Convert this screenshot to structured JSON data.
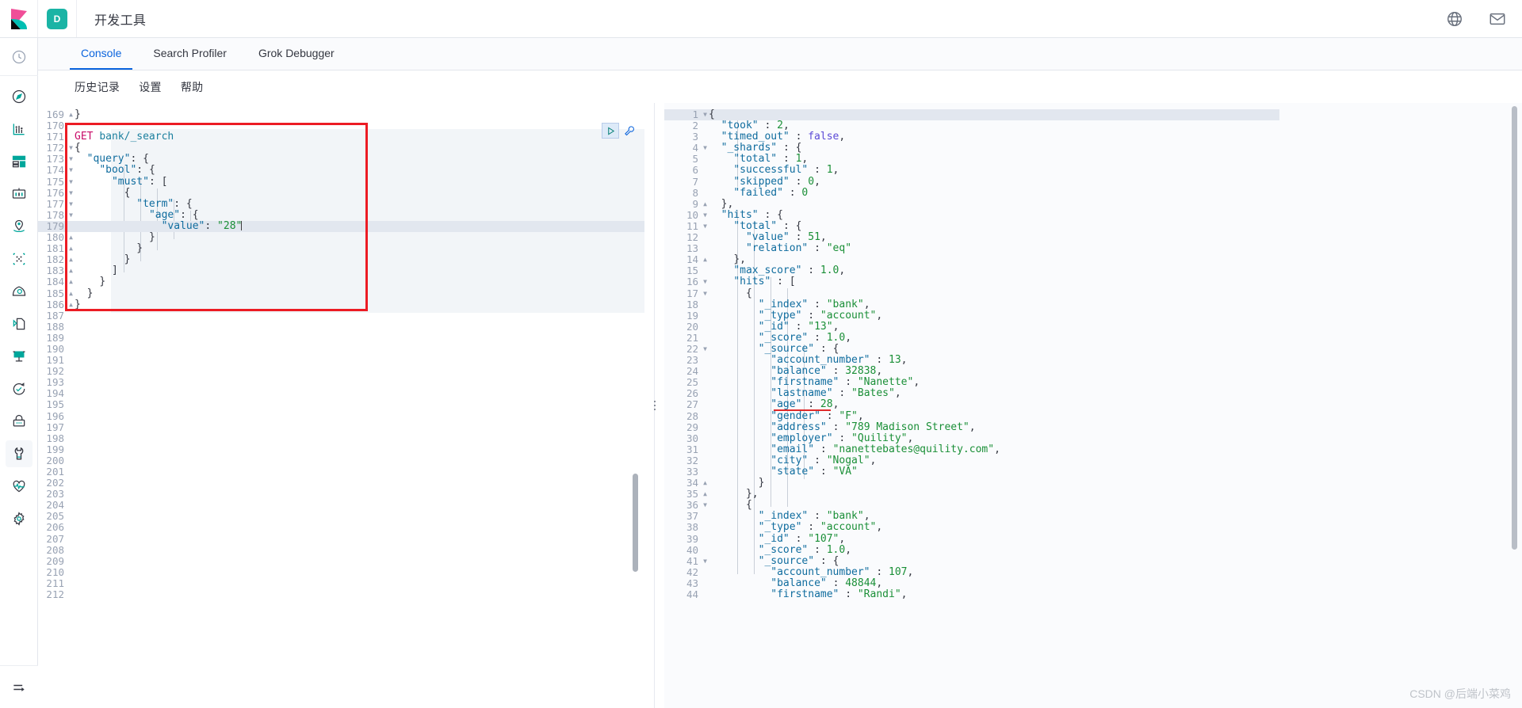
{
  "header": {
    "logo_icon": "kibana-logo",
    "space_badge": "D",
    "title": "开发工具",
    "icons": [
      {
        "name": "help-globe-icon"
      },
      {
        "name": "mail-icon"
      }
    ]
  },
  "sidebar": {
    "recent_icon": "recently-viewed-clock-icon",
    "items": [
      {
        "name": "sidebar-item-discover",
        "icon": "compass-icon",
        "active": false
      },
      {
        "name": "sidebar-item-visualize",
        "icon": "bar-chart-icon",
        "active": false
      },
      {
        "name": "sidebar-item-dashboard",
        "icon": "dashboard-icon",
        "active": false
      },
      {
        "name": "sidebar-item-canvas",
        "icon": "canvas-icon",
        "active": false
      },
      {
        "name": "sidebar-item-maps",
        "icon": "map-marker-icon",
        "active": false
      },
      {
        "name": "sidebar-item-machine-learning",
        "icon": "machine-learning-icon",
        "active": false
      },
      {
        "name": "sidebar-item-infrastructure",
        "icon": "infrastructure-icon",
        "active": false
      },
      {
        "name": "sidebar-item-logs",
        "icon": "logs-icon",
        "active": false
      },
      {
        "name": "sidebar-item-apm",
        "icon": "apm-icon",
        "active": false
      },
      {
        "name": "sidebar-item-uptime",
        "icon": "uptime-clock-icon",
        "active": false
      },
      {
        "name": "sidebar-item-security",
        "icon": "lock-icon",
        "active": false
      },
      {
        "name": "sidebar-item-dev-tools",
        "icon": "wrench-icon",
        "active": true
      },
      {
        "name": "sidebar-item-monitoring",
        "icon": "heartbeat-icon",
        "active": false
      },
      {
        "name": "sidebar-item-management",
        "icon": "gear-icon",
        "active": false
      }
    ],
    "collapse_icon": "collapse-nav-arrow-icon"
  },
  "tabs": [
    {
      "label": "Console",
      "active": true
    },
    {
      "label": "Search Profiler",
      "active": false
    },
    {
      "label": "Grok Debugger",
      "active": false
    }
  ],
  "subbar": {
    "links": [
      {
        "label": "历史记录",
        "name": "history-link"
      },
      {
        "label": "设置",
        "name": "settings-link"
      },
      {
        "label": "帮助",
        "name": "help-link"
      }
    ]
  },
  "request_editor": {
    "name": "console-request-editor",
    "play_button_icon": "play-triangle-icon",
    "wrench_button_icon": "wrench-icon",
    "first_line_number": 169,
    "last_line_number": 212,
    "highlighted_line": 179,
    "lines": [
      {
        "n": 169,
        "fold": "up",
        "text": "}"
      },
      {
        "n": 170,
        "fold": "",
        "text": ""
      },
      {
        "n": 171,
        "fold": "",
        "text": "GET bank/_search"
      },
      {
        "n": 172,
        "fold": "down",
        "text": "{"
      },
      {
        "n": 173,
        "fold": "down",
        "text": "  \"query\": {"
      },
      {
        "n": 174,
        "fold": "down",
        "text": "    \"bool\": {"
      },
      {
        "n": 175,
        "fold": "down",
        "text": "      \"must\": ["
      },
      {
        "n": 176,
        "fold": "down",
        "text": "        {"
      },
      {
        "n": 177,
        "fold": "down",
        "text": "          \"term\": {"
      },
      {
        "n": 178,
        "fold": "down",
        "text": "            \"age\": {"
      },
      {
        "n": 179,
        "fold": "",
        "text": "              \"value\": \"28\""
      },
      {
        "n": 180,
        "fold": "up",
        "text": "            }"
      },
      {
        "n": 181,
        "fold": "up",
        "text": "          }"
      },
      {
        "n": 182,
        "fold": "up",
        "text": "        }"
      },
      {
        "n": 183,
        "fold": "up",
        "text": "      ]"
      },
      {
        "n": 184,
        "fold": "up",
        "text": "    }"
      },
      {
        "n": 185,
        "fold": "up",
        "text": "  }"
      },
      {
        "n": 186,
        "fold": "up",
        "text": "}"
      },
      {
        "n": 187,
        "fold": "",
        "text": ""
      },
      {
        "n": 188,
        "fold": "",
        "text": ""
      },
      {
        "n": 189,
        "fold": "",
        "text": ""
      },
      {
        "n": 190,
        "fold": "",
        "text": ""
      },
      {
        "n": 191,
        "fold": "",
        "text": ""
      },
      {
        "n": 192,
        "fold": "",
        "text": ""
      },
      {
        "n": 193,
        "fold": "",
        "text": ""
      },
      {
        "n": 194,
        "fold": "",
        "text": ""
      },
      {
        "n": 195,
        "fold": "",
        "text": ""
      },
      {
        "n": 196,
        "fold": "",
        "text": ""
      },
      {
        "n": 197,
        "fold": "",
        "text": ""
      },
      {
        "n": 198,
        "fold": "",
        "text": ""
      },
      {
        "n": 199,
        "fold": "",
        "text": ""
      },
      {
        "n": 200,
        "fold": "",
        "text": ""
      },
      {
        "n": 201,
        "fold": "",
        "text": ""
      },
      {
        "n": 202,
        "fold": "",
        "text": ""
      },
      {
        "n": 203,
        "fold": "",
        "text": ""
      },
      {
        "n": 204,
        "fold": "",
        "text": ""
      },
      {
        "n": 205,
        "fold": "",
        "text": ""
      },
      {
        "n": 206,
        "fold": "",
        "text": ""
      },
      {
        "n": 207,
        "fold": "",
        "text": ""
      },
      {
        "n": 208,
        "fold": "",
        "text": ""
      },
      {
        "n": 209,
        "fold": "",
        "text": ""
      },
      {
        "n": 210,
        "fold": "",
        "text": ""
      },
      {
        "n": 211,
        "fold": "",
        "text": ""
      },
      {
        "n": 212,
        "fold": "",
        "text": ""
      }
    ]
  },
  "response_editor": {
    "name": "console-response-editor",
    "first_line_number": 1,
    "last_line_number": 44,
    "highlighted_line": 1,
    "annotated_line": 27,
    "lines": [
      {
        "n": 1,
        "fold": "down",
        "text": "{"
      },
      {
        "n": 2,
        "fold": "",
        "text": "  \"took\" : 2,"
      },
      {
        "n": 3,
        "fold": "",
        "text": "  \"timed_out\" : false,"
      },
      {
        "n": 4,
        "fold": "down",
        "text": "  \"_shards\" : {"
      },
      {
        "n": 5,
        "fold": "",
        "text": "    \"total\" : 1,"
      },
      {
        "n": 6,
        "fold": "",
        "text": "    \"successful\" : 1,"
      },
      {
        "n": 7,
        "fold": "",
        "text": "    \"skipped\" : 0,"
      },
      {
        "n": 8,
        "fold": "",
        "text": "    \"failed\" : 0"
      },
      {
        "n": 9,
        "fold": "up",
        "text": "  },"
      },
      {
        "n": 10,
        "fold": "down",
        "text": "  \"hits\" : {"
      },
      {
        "n": 11,
        "fold": "down",
        "text": "    \"total\" : {"
      },
      {
        "n": 12,
        "fold": "",
        "text": "      \"value\" : 51,"
      },
      {
        "n": 13,
        "fold": "",
        "text": "      \"relation\" : \"eq\""
      },
      {
        "n": 14,
        "fold": "up",
        "text": "    },"
      },
      {
        "n": 15,
        "fold": "",
        "text": "    \"max_score\" : 1.0,"
      },
      {
        "n": 16,
        "fold": "down",
        "text": "    \"hits\" : ["
      },
      {
        "n": 17,
        "fold": "down",
        "text": "      {"
      },
      {
        "n": 18,
        "fold": "",
        "text": "        \"_index\" : \"bank\","
      },
      {
        "n": 19,
        "fold": "",
        "text": "        \"_type\" : \"account\","
      },
      {
        "n": 20,
        "fold": "",
        "text": "        \"_id\" : \"13\","
      },
      {
        "n": 21,
        "fold": "",
        "text": "        \"_score\" : 1.0,"
      },
      {
        "n": 22,
        "fold": "down",
        "text": "        \"_source\" : {"
      },
      {
        "n": 23,
        "fold": "",
        "text": "          \"account_number\" : 13,"
      },
      {
        "n": 24,
        "fold": "",
        "text": "          \"balance\" : 32838,"
      },
      {
        "n": 25,
        "fold": "",
        "text": "          \"firstname\" : \"Nanette\","
      },
      {
        "n": 26,
        "fold": "",
        "text": "          \"lastname\" : \"Bates\","
      },
      {
        "n": 27,
        "fold": "",
        "text": "          \"age\" : 28,"
      },
      {
        "n": 28,
        "fold": "",
        "text": "          \"gender\" : \"F\","
      },
      {
        "n": 29,
        "fold": "",
        "text": "          \"address\" : \"789 Madison Street\","
      },
      {
        "n": 30,
        "fold": "",
        "text": "          \"employer\" : \"Quility\","
      },
      {
        "n": 31,
        "fold": "",
        "text": "          \"email\" : \"nanettebates@quility.com\","
      },
      {
        "n": 32,
        "fold": "",
        "text": "          \"city\" : \"Nogal\","
      },
      {
        "n": 33,
        "fold": "",
        "text": "          \"state\" : \"VA\""
      },
      {
        "n": 34,
        "fold": "up",
        "text": "        }"
      },
      {
        "n": 35,
        "fold": "up",
        "text": "      },"
      },
      {
        "n": 36,
        "fold": "down",
        "text": "      {"
      },
      {
        "n": 37,
        "fold": "",
        "text": "        \"_index\" : \"bank\","
      },
      {
        "n": 38,
        "fold": "",
        "text": "        \"_type\" : \"account\","
      },
      {
        "n": 39,
        "fold": "",
        "text": "        \"_id\" : \"107\","
      },
      {
        "n": 40,
        "fold": "",
        "text": "        \"_score\" : 1.0,"
      },
      {
        "n": 41,
        "fold": "down",
        "text": "        \"_source\" : {"
      },
      {
        "n": 42,
        "fold": "",
        "text": "          \"account_number\" : 107,"
      },
      {
        "n": 43,
        "fold": "",
        "text": "          \"balance\" : 48844,"
      },
      {
        "n": 44,
        "fold": "",
        "text": "          \"firstname\" : \"Randi\","
      }
    ]
  },
  "annotations": {
    "request_box_color": "#ec1c24",
    "age_underline_color": "#e02a2a"
  },
  "watermark": {
    "text": "CSDN @后端小菜鸡"
  }
}
